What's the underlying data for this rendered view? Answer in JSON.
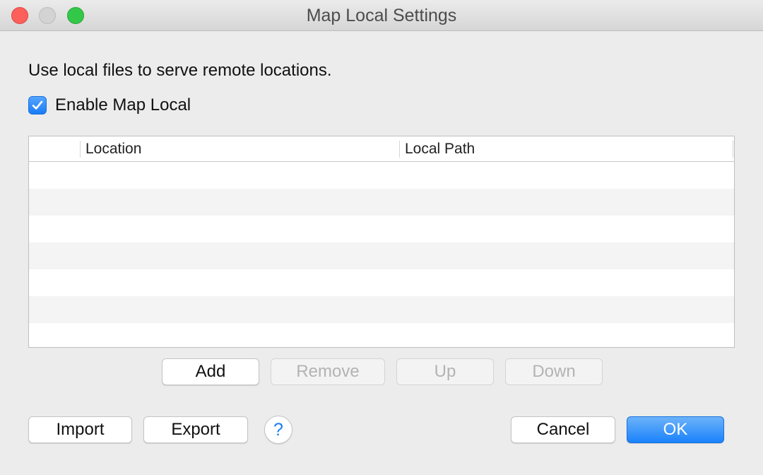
{
  "window": {
    "title": "Map Local Settings"
  },
  "description": "Use local files to serve remote locations.",
  "enable": {
    "label": "Enable Map Local",
    "checked": true
  },
  "table": {
    "columns": [
      "Location",
      "Local Path"
    ],
    "rows": []
  },
  "row_buttons": {
    "add": "Add",
    "remove": "Remove",
    "up": "Up",
    "down": "Down"
  },
  "footer": {
    "import": "Import",
    "export": "Export",
    "help": "?",
    "cancel": "Cancel",
    "ok": "OK"
  },
  "colors": {
    "accent": "#1a7cf6",
    "close": "#fc605b",
    "maximize": "#34c84a"
  }
}
